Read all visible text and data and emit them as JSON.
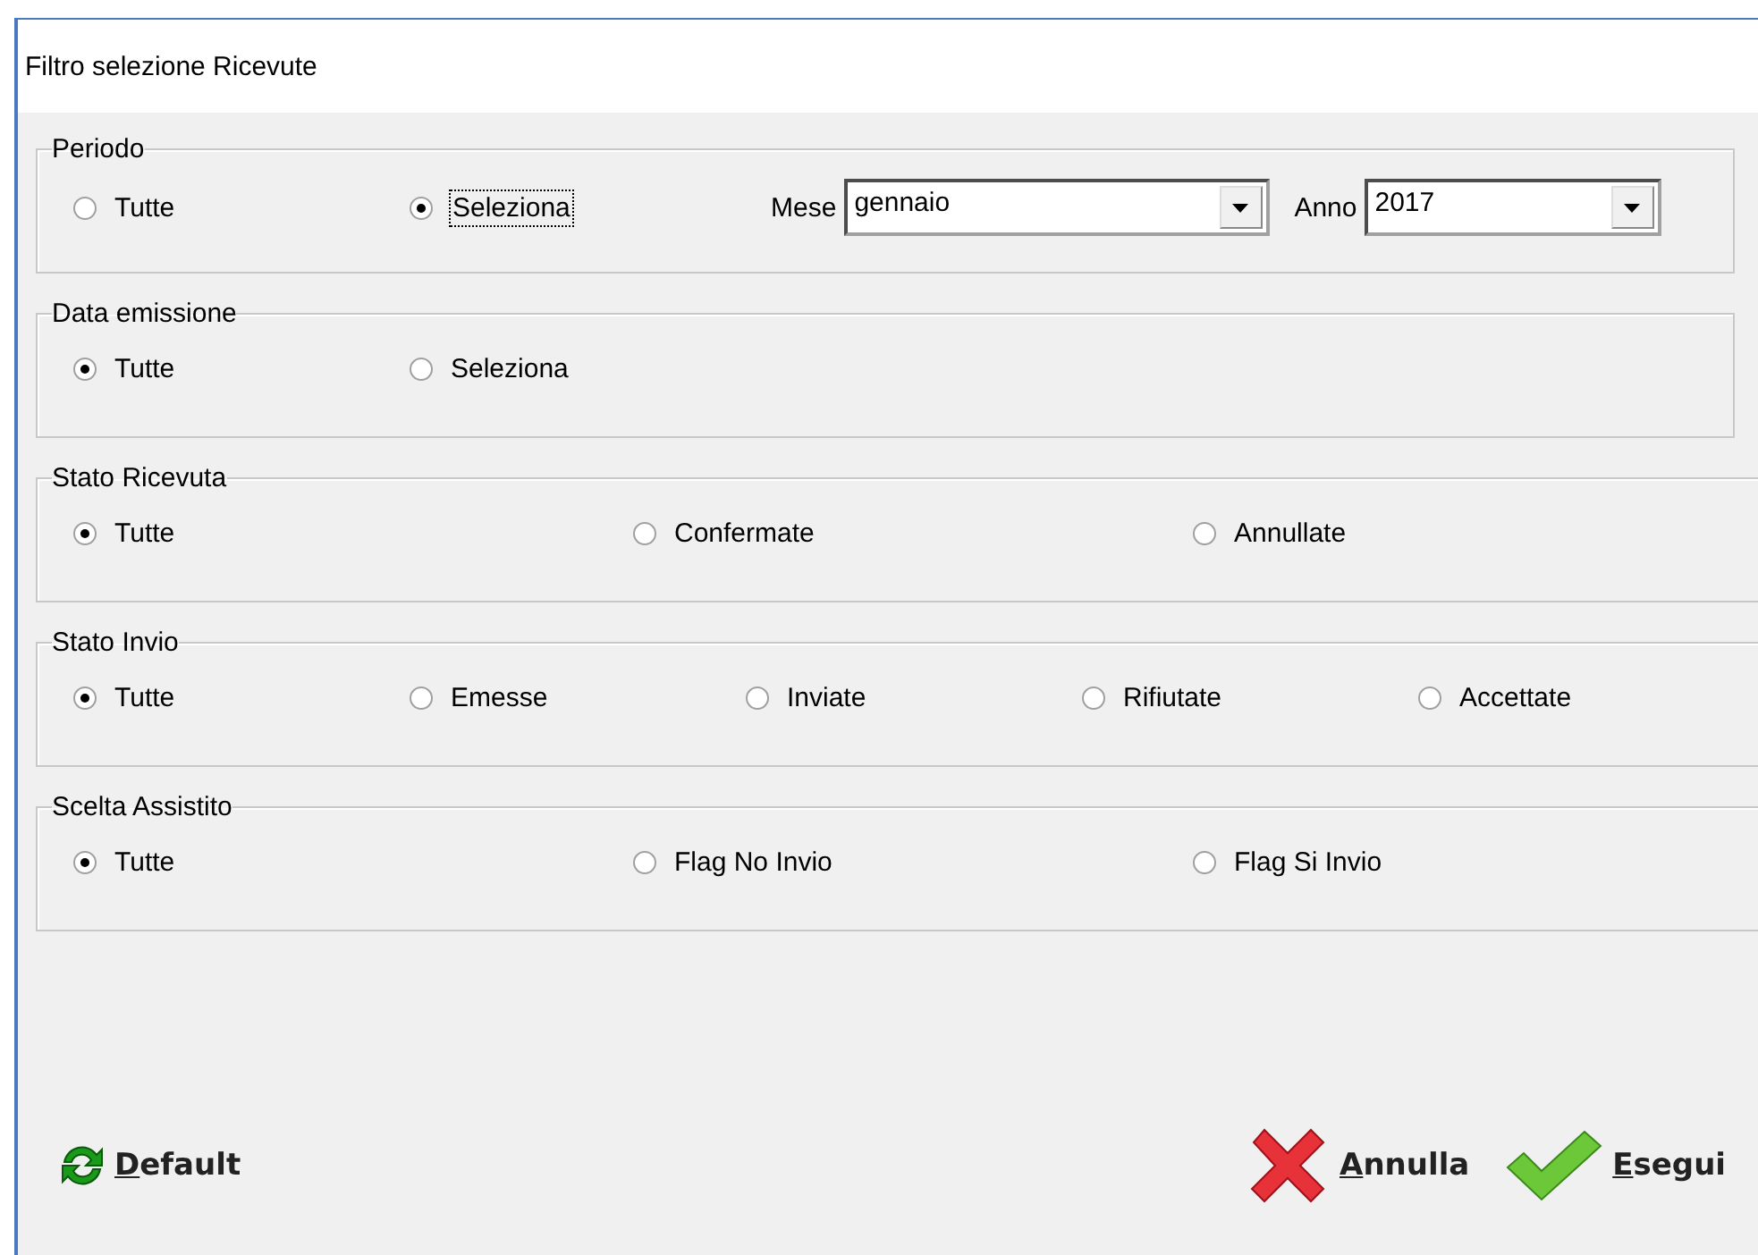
{
  "window": {
    "title": "Filtro selezione Ricevute"
  },
  "groups": [
    {
      "title": "Periodo",
      "options": [
        {
          "label": "Tutte",
          "selected": false,
          "focused": false
        },
        {
          "label": "Seleziona",
          "selected": true,
          "focused": true
        }
      ],
      "fields": [
        {
          "label": "Mese",
          "value": "gennaio"
        },
        {
          "label": "Anno",
          "value": "2017"
        }
      ]
    },
    {
      "title": "Data emissione",
      "options": [
        {
          "label": "Tutte",
          "selected": true,
          "focused": false
        },
        {
          "label": "Seleziona",
          "selected": false,
          "focused": false
        }
      ]
    },
    {
      "title": "Stato Ricevuta",
      "options": [
        {
          "label": "Tutte",
          "selected": true,
          "focused": false
        },
        {
          "label": "Confermate",
          "selected": false,
          "focused": false
        },
        {
          "label": "Annullate",
          "selected": false,
          "focused": false
        }
      ]
    },
    {
      "title": "Stato Invio",
      "options": [
        {
          "label": "Tutte",
          "selected": true,
          "focused": false
        },
        {
          "label": "Emesse",
          "selected": false,
          "focused": false
        },
        {
          "label": "Inviate",
          "selected": false,
          "focused": false
        },
        {
          "label": "Rifiutate",
          "selected": false,
          "focused": false
        },
        {
          "label": "Accettate",
          "selected": false,
          "focused": false
        }
      ]
    },
    {
      "title": "Scelta Assistito",
      "options": [
        {
          "label": "Tutte",
          "selected": true,
          "focused": false
        },
        {
          "label": "Flag No Invio",
          "selected": false,
          "focused": false
        },
        {
          "label": "Flag Si Invio",
          "selected": false,
          "focused": false
        }
      ]
    }
  ],
  "buttons": [
    {
      "label": "Default",
      "kind": "default"
    },
    {
      "label": "Annulla",
      "kind": "cancel"
    },
    {
      "label": "Esegui",
      "kind": "ok"
    }
  ]
}
